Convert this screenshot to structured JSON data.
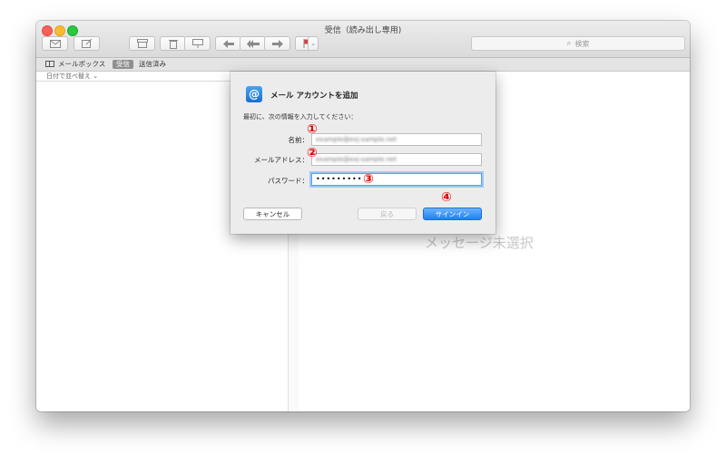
{
  "window": {
    "title": "受信（読み出し専用)"
  },
  "toolbar": {
    "get_mail": "envelope-icon",
    "compose": "compose-icon",
    "archive": "archive-icon",
    "delete": "trash-icon",
    "junk": "junk-icon",
    "reply": "reply-icon",
    "reply_all": "reply-all-icon",
    "forward": "forward-icon",
    "flag": "flag-icon",
    "flag_color": "#e23a3a",
    "search_icon": "⌕",
    "search_placeholder": "検索"
  },
  "favorites": {
    "mailboxes": "メールボックス",
    "inbox": "受信",
    "sent": "送信済み"
  },
  "list": {
    "sort_label": "日付で並べ替え ⌄"
  },
  "viewer": {
    "empty_text": "メッセージ未選択"
  },
  "sheet": {
    "icon": "@",
    "title": "メール アカウントを追加",
    "instruction": "最初に、次の情報を入力してください：",
    "fields": [
      {
        "label": "名前：",
        "value": "example@exj-sample.net"
      },
      {
        "label": "メールアドレス：",
        "value": "example@exj-sample.net"
      },
      {
        "label": "パスワード：",
        "value": "•••••••••"
      }
    ],
    "buttons": {
      "cancel": "キャンセル",
      "back": "戻る",
      "signin": "サインイン"
    }
  },
  "markers": [
    "①",
    "②",
    "③",
    "④"
  ],
  "colors": {
    "marker": "#e20000",
    "accent": "#1d80f5"
  }
}
